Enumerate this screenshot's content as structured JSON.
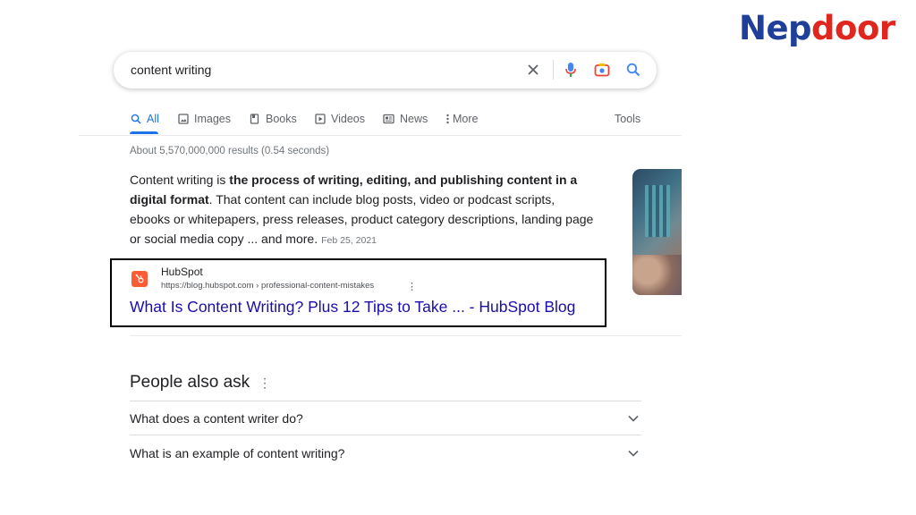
{
  "brand": {
    "part1": "Nep",
    "part2": "door"
  },
  "search": {
    "query": "content writing"
  },
  "icons": {
    "clear": "close-icon",
    "voice": "microphone-icon",
    "lens": "camera-icon",
    "search": "search-icon"
  },
  "tabs": [
    {
      "label": "All",
      "icon": "search-icon",
      "active": true
    },
    {
      "label": "Images",
      "icon": "image-icon"
    },
    {
      "label": "Books",
      "icon": "book-icon"
    },
    {
      "label": "Videos",
      "icon": "play-icon"
    },
    {
      "label": "News",
      "icon": "news-icon"
    },
    {
      "label": "More",
      "icon": "more-vertical-icon"
    }
  ],
  "tools_label": "Tools",
  "stats": "About 5,570,000,000 results (0.54 seconds)",
  "snippet": {
    "lead": "Content writing is ",
    "bold": "the process of writing, editing, and publishing content in a digital format",
    "rest": ". That content can include blog posts, video or podcast scripts, ebooks or whitepapers, press releases, product category descriptions, landing page or social media copy ... and more.",
    "date": "Feb 25, 2021"
  },
  "source": {
    "site_name": "HubSpot",
    "url": "https://blog.hubspot.com › professional-content-mistakes",
    "title": "What Is Content Writing? Plus 12 Tips to Take ... - HubSpot Blog"
  },
  "people_also_ask": {
    "title": "People also ask",
    "questions": [
      "What does a content writer do?",
      "What is an example of content writing?"
    ]
  },
  "colors": {
    "brand_blue": "#1f3f9a",
    "brand_red": "#e0271f",
    "link": "#1a0dab",
    "accent": "#1a73e8"
  }
}
